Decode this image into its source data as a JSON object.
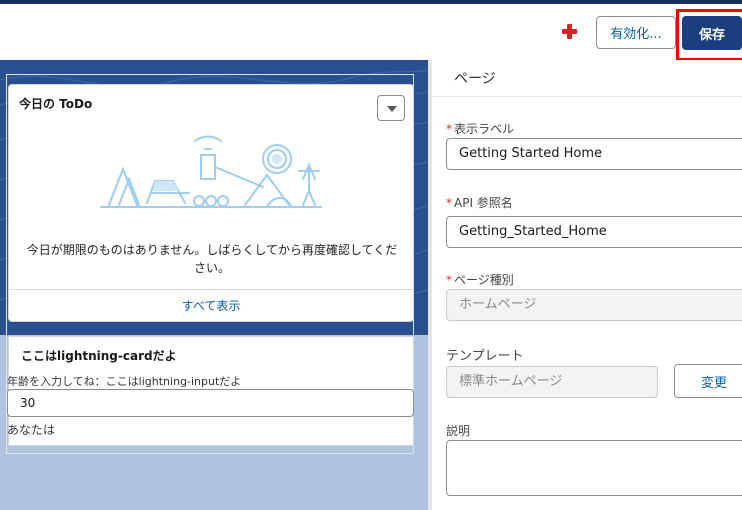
{
  "header": {
    "activate_label": "有効化...",
    "save_label": "保存"
  },
  "todo_card": {
    "title": "今日の ToDo",
    "empty_message": "今日が期限のものはありません。しばらくしてから再度確認してください。",
    "view_all": "すべて表示"
  },
  "lightning_card": {
    "title": "ここはlightning-cardだよ",
    "input_label": "年齢を入力してね：ここはlightning-inputだよ",
    "input_value": "30",
    "result_text": "あなたは"
  },
  "panel": {
    "title": "ページ",
    "label_field": {
      "label": "表示ラベル",
      "required_mark": "*",
      "value": "Getting Started Home"
    },
    "api_field": {
      "label": "API 参照名",
      "required_mark": "*",
      "value": "Getting_Started_Home"
    },
    "type_field": {
      "label": "ページ種別",
      "required_mark": "*",
      "value": "ホームページ"
    },
    "template_field": {
      "label": "テンプレート",
      "value": "標準ホームページ",
      "change_label": "変更"
    },
    "description_field": {
      "label": "説明",
      "value": ""
    }
  },
  "colors": {
    "brand": "#1b3e7e",
    "link": "#0b5cab",
    "highlight": "#ff0000",
    "add_icon": "#e02020",
    "canvas": "#b0c4df"
  }
}
